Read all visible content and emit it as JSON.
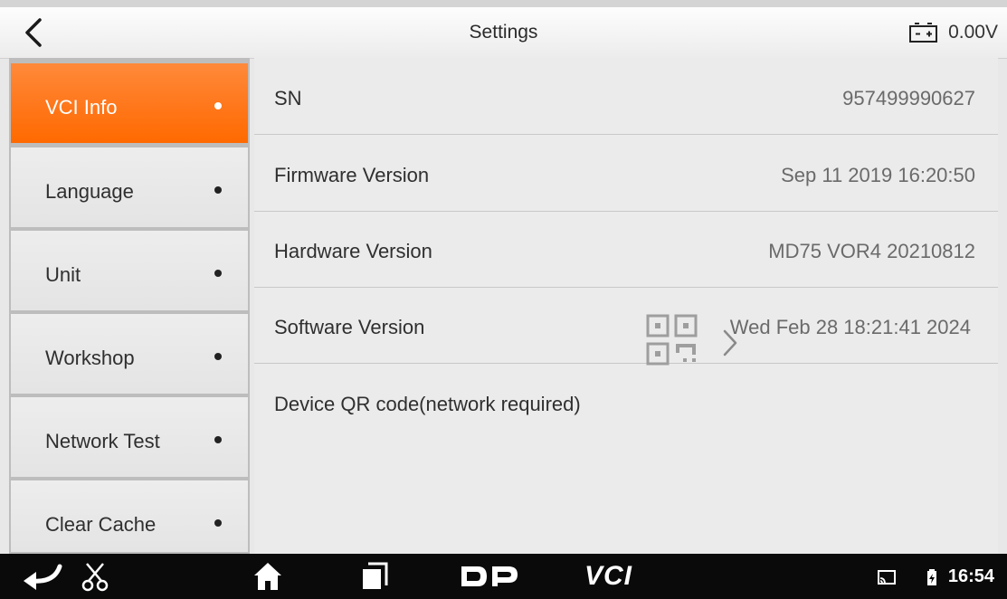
{
  "header": {
    "title": "Settings",
    "battery_voltage": "0.00V",
    "back_icon": "chevron-left-icon",
    "battery_icon": "battery-icon"
  },
  "sidebar": {
    "items": [
      {
        "label": "VCI Info",
        "active": true
      },
      {
        "label": "Language",
        "active": false
      },
      {
        "label": "Unit",
        "active": false
      },
      {
        "label": "Workshop",
        "active": false
      },
      {
        "label": "Network Test",
        "active": false
      },
      {
        "label": "Clear Cache",
        "active": false
      }
    ]
  },
  "vci_info": {
    "rows": [
      {
        "label": "SN",
        "value": "957499990627"
      },
      {
        "label": "Firmware Version",
        "value": "Sep 11 2019 16:20:50"
      },
      {
        "label": "Hardware Version",
        "value": "MD75 VOR4 20210812"
      },
      {
        "label": "Software Version",
        "value": "Wed Feb 28 18:21:41 2024"
      },
      {
        "label": "Device QR code(network required)",
        "value": ""
      }
    ]
  },
  "navbar": {
    "dp_logo": "DP",
    "vci_logo": "VCI",
    "time": "16:54"
  },
  "colors": {
    "accent": "#ff7a20",
    "navbar": "#0a0a0a"
  }
}
